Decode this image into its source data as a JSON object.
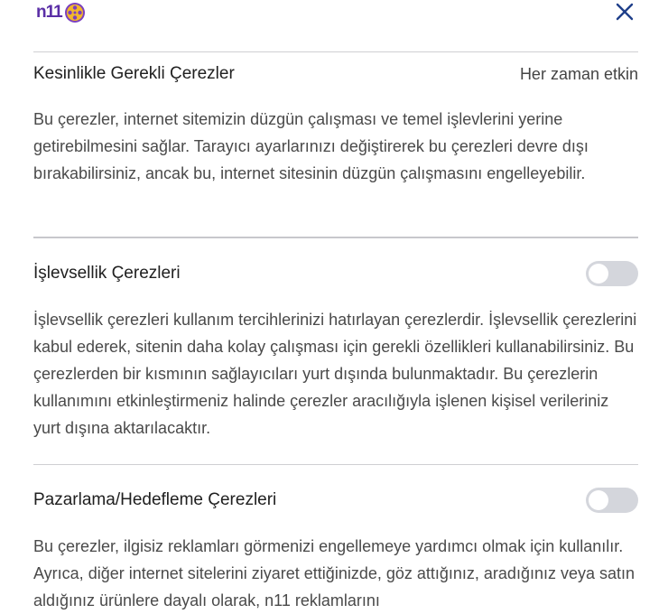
{
  "header": {
    "logo_text": "n11",
    "close_icon": "close-icon"
  },
  "sections": [
    {
      "title": "Kesinlikle Gerekli Çerezler",
      "status": "Her zaman etkin",
      "description": "Bu çerezler, internet sitemizin düzgün çalışması ve temel işlevlerini yerine getirebilmesini sağlar. Tarayıcı ayarlarınızı değiştirerek bu çerezleri devre dışı bırakabilirsiniz, ancak bu, internet sitesinin düzgün çalışmasını engelleyebilir."
    },
    {
      "title": "İşlevsellik Çerezleri",
      "toggle_on": false,
      "description": "İşlevsellik çerezleri kullanım tercihlerinizi hatırlayan çerezlerdir. İşlevsellik çerezlerini kabul ederek, sitenin daha kolay çalışması için gerekli özellikleri kullanabilirsiniz. Bu çerezlerden bir kısmının sağlayıcıları yurt dışında bulunmaktadır. Bu çerezlerin kullanımını etkinleştirmeniz halinde çerezler aracılığıyla işlenen kişisel verileriniz yurt dışına aktarılacaktır."
    },
    {
      "title": "Pazarlama/Hedefleme Çerezleri",
      "toggle_on": false,
      "description": "Bu çerezler, ilgisiz reklamları görmenizi engellemeye yardımcı olmak için kullanılır. Ayrıca, diğer internet sitelerini ziyaret ettiğinizde, göz attığınız, aradığınız veya satın aldığınız ürünlere dayalı olarak, n11 reklamlarını"
    }
  ],
  "colors": {
    "brand": "#5a2ea6",
    "close": "#1f3f8a",
    "toggle_off": "#d4d6dc"
  }
}
